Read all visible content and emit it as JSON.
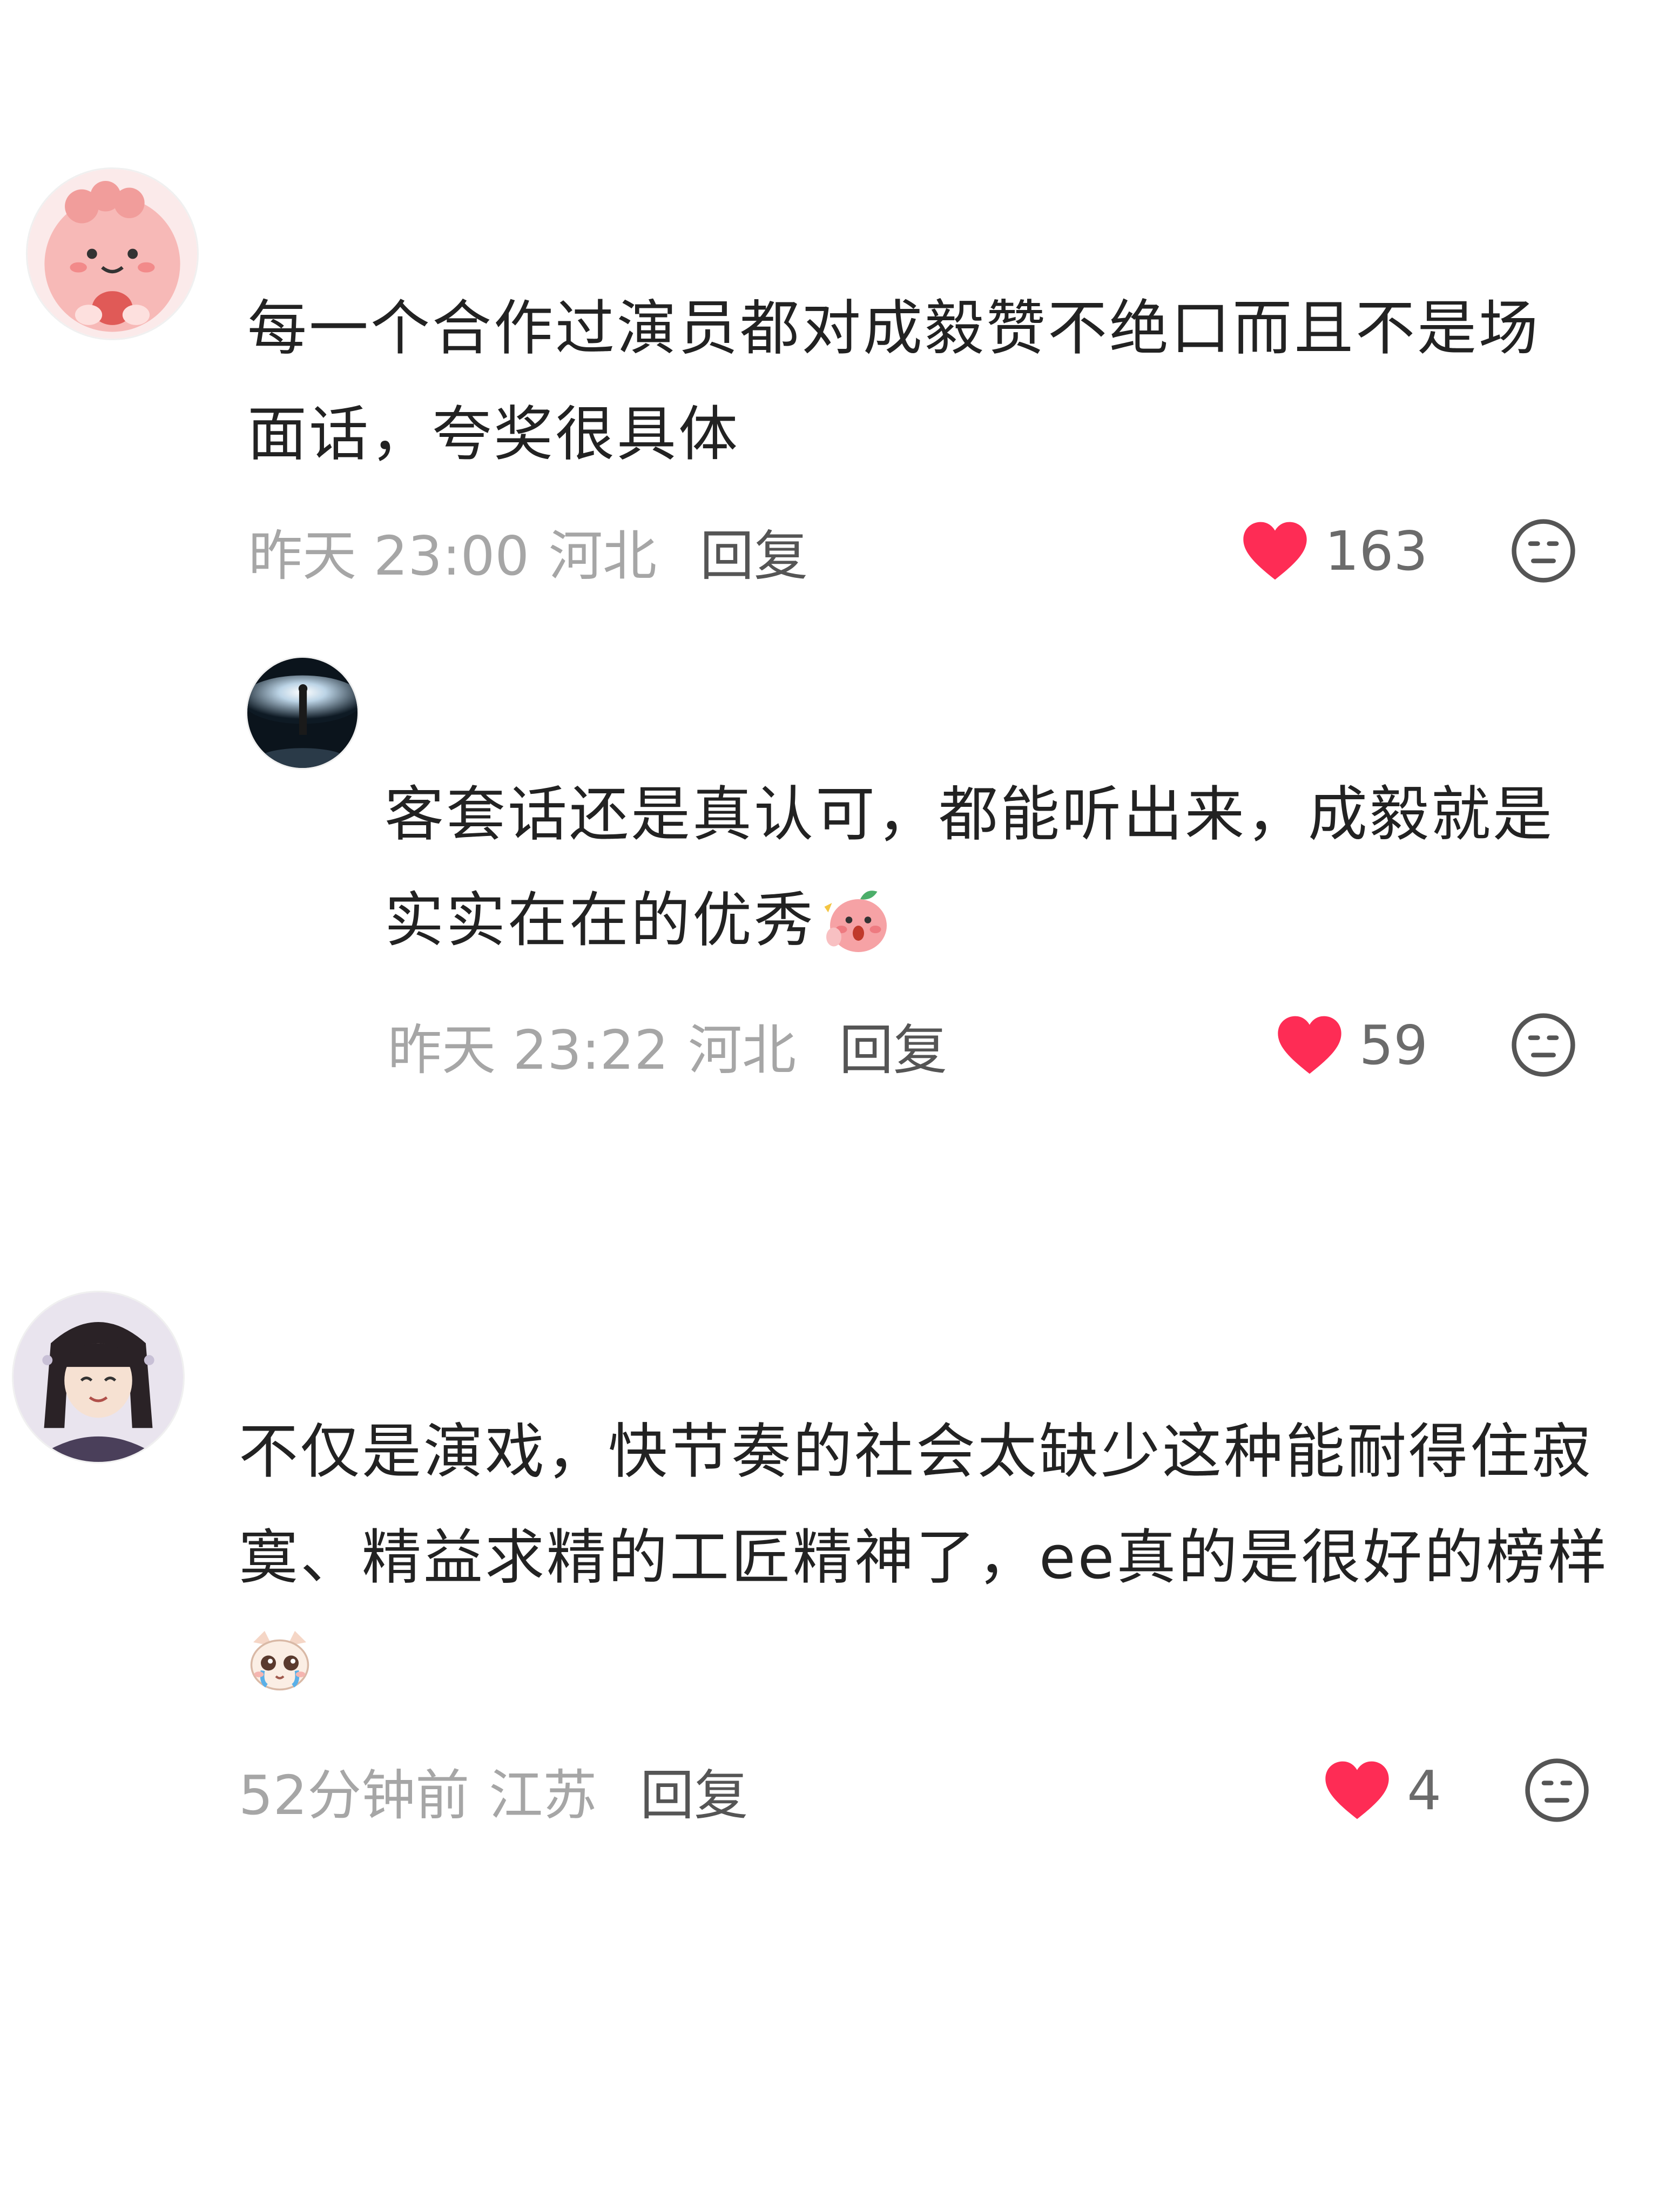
{
  "comments": [
    {
      "text": "每一个合作过演员都对成毅赞不绝口而且不是场面话，夸奖很具体",
      "time": "昨天 23:00",
      "location": "河北",
      "reply_label": "回复",
      "likes": "163",
      "avatar_icon": "pink-cartoon-avatar"
    },
    {
      "text": "客套话还是真认可，都能听出来，成毅就是实实在在的优秀",
      "emoji_icon": "peach-cheer-emoji",
      "time": "昨天 23:22",
      "location": "河北",
      "reply_label": "回复",
      "likes": "59",
      "avatar_icon": "stage-light-avatar"
    },
    {
      "text": "不仅是演戏，快节奏的社会太缺少这种能耐得住寂寞、精益求精的工匠精神了，ee真的是很好的榜样",
      "emoji_icon": "crying-cat-emoji",
      "time": "52分钟前",
      "location": "江苏",
      "reply_label": "回复",
      "likes": "4",
      "avatar_icon": "anime-girl-avatar"
    }
  ],
  "colors": {
    "like_heart": "#fe2c55",
    "meta_text": "#a6a6a6",
    "reply_text": "#555555",
    "body_text": "#222222"
  }
}
